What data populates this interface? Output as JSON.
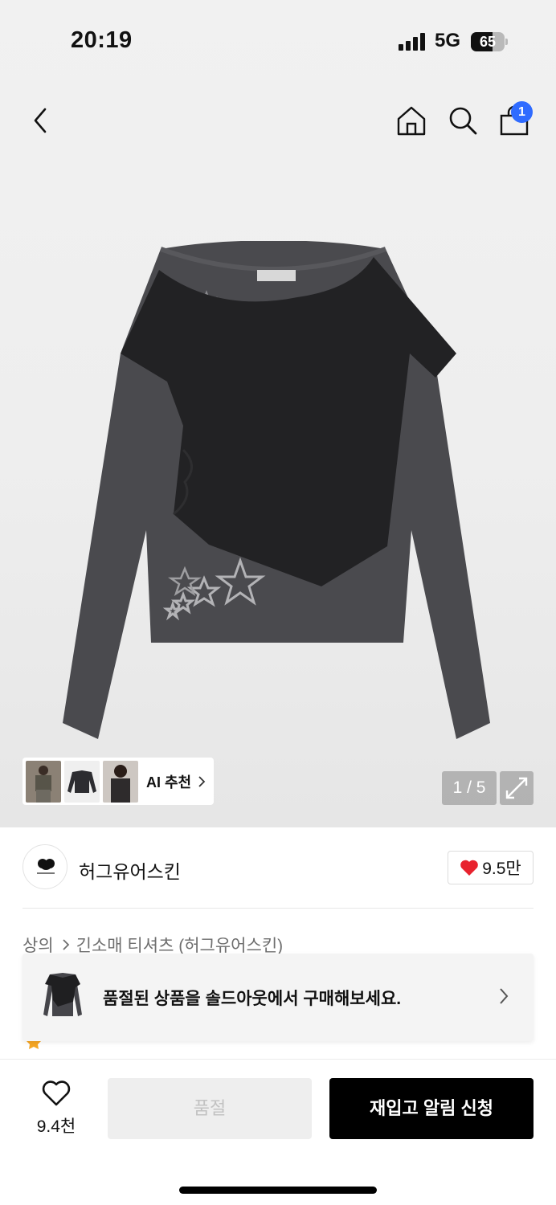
{
  "status_bar": {
    "time": "20:19",
    "network": "5G",
    "battery": "65",
    "battery_level": 0.65
  },
  "nav": {
    "cart_count": "1",
    "icons": [
      "back-arrow-icon",
      "home-icon",
      "search-icon",
      "shopping-bag-icon"
    ]
  },
  "gallery": {
    "ai_recommend_label": "AI 추천",
    "counter": "1 / 5",
    "thumbnails": [
      "model-photo",
      "product-photo",
      "model-photo"
    ]
  },
  "brand": {
    "name": "허그유어스킨",
    "like_count": "9.5만"
  },
  "breadcrumb": {
    "category": "상의",
    "subcategory": "긴소매 티셔츠 (허그유어스킨)"
  },
  "soldout_banner": {
    "text": "품절된 상품을 솔드아웃에서 구매해보세요."
  },
  "bottom_bar": {
    "wish_count": "9.4천",
    "soldout_label": "품절",
    "restock_label": "재입고 알림 신청"
  },
  "colors": {
    "accent_badge": "#2f6bff",
    "like_heart": "#e8222e",
    "primary_button": "#000000"
  }
}
